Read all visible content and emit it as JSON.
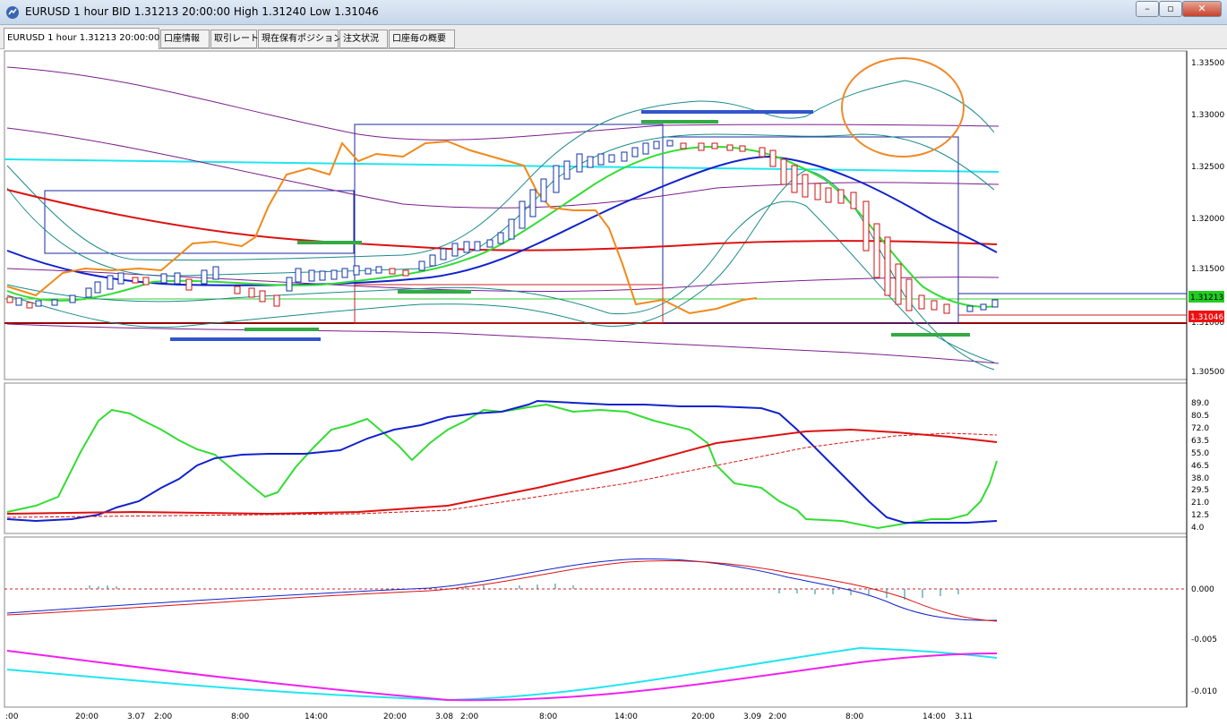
{
  "window": {
    "title": "EURUSD 1 hour BID 1.31213 20:00:00 High 1.31240 Low 1.31046",
    "minimize_icon": "minimize-icon",
    "maximize_icon": "maximize-icon",
    "close_icon": "close-icon"
  },
  "tabs": [
    {
      "label": "EURUSD 1 hour 1.31213 20:00:00"
    },
    {
      "label": "口座情報"
    },
    {
      "label": "取引レート"
    },
    {
      "label": "現在保有ポジション"
    },
    {
      "label": "注文状況"
    },
    {
      "label": "口座毎の概要"
    }
  ],
  "price_panel": {
    "y_ticks": [
      "1.33500",
      "1.33000",
      "1.32500",
      "1.32000",
      "1.31500",
      "1.31000",
      "1.30500"
    ],
    "current_price_label": "1.31213",
    "low_price_label": "1.31046",
    "colors": {
      "bid_tag": "#22cc22",
      "low_tag": "#ee1111",
      "candle_up": "#1133aa",
      "candle_down": "#cc1111",
      "highlight_circle": "#f08a2a"
    }
  },
  "stoch_panel": {
    "y_ticks": [
      "89.0",
      "80.5",
      "72.0",
      "63.5",
      "55.0",
      "46.5",
      "38.0",
      "29.5",
      "21.0",
      "12.5",
      "4.0"
    ]
  },
  "macd_panel": {
    "y_ticks": [
      "0.000",
      "-0.005",
      "-0.010"
    ]
  },
  "x_axis": {
    "ticks": [
      ":00",
      "20:00",
      "3.07",
      "2:00",
      "8:00",
      "14:00",
      "20:00",
      "3.08",
      "2:00",
      "8:00",
      "14:00",
      "20:00",
      "3.09",
      "2:00",
      "8:00",
      "14:00",
      "3.11"
    ]
  }
}
